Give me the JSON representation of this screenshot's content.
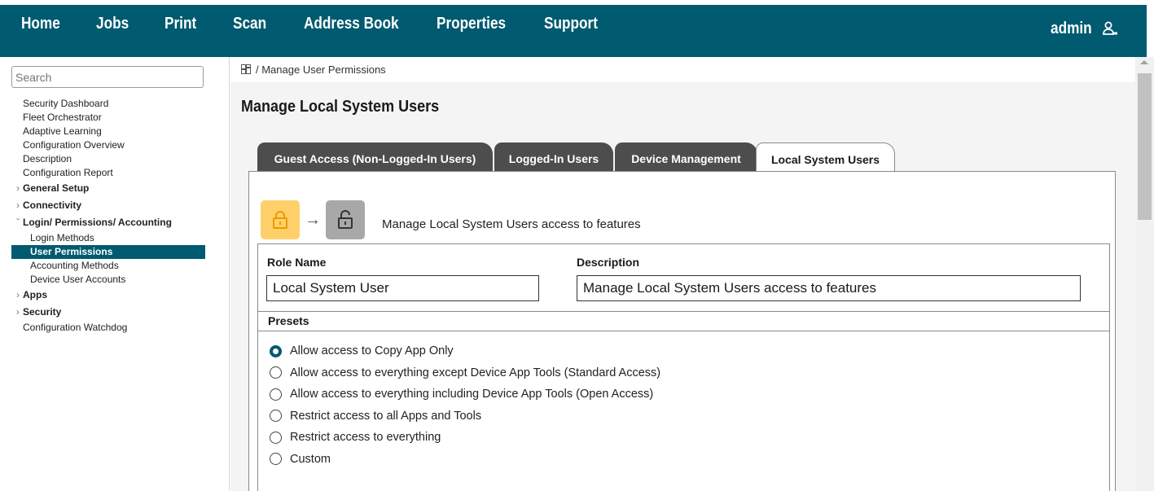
{
  "nav": {
    "items": [
      "Home",
      "Jobs",
      "Print",
      "Scan",
      "Address Book",
      "Properties",
      "Support"
    ],
    "user": "admin"
  },
  "sidebar": {
    "search_placeholder": "Search",
    "items": [
      {
        "label": "Security Dashboard",
        "kind": "top"
      },
      {
        "label": "Fleet Orchestrator",
        "kind": "top"
      },
      {
        "label": "Adaptive Learning",
        "kind": "top"
      },
      {
        "label": "Configuration Overview",
        "kind": "top"
      },
      {
        "label": "Description",
        "kind": "top"
      },
      {
        "label": "Configuration Report",
        "kind": "top"
      },
      {
        "label": "General Setup",
        "kind": "group",
        "chev": "›"
      },
      {
        "label": "Connectivity",
        "kind": "group",
        "chev": "›"
      },
      {
        "label": "Login/ Permissions/ Accounting",
        "kind": "group",
        "chev": "ˇ"
      },
      {
        "label": "Login Methods",
        "kind": "sub"
      },
      {
        "label": "User Permissions",
        "kind": "active"
      },
      {
        "label": "Accounting Methods",
        "kind": "sub"
      },
      {
        "label": "Device User Accounts",
        "kind": "sub"
      },
      {
        "label": "Apps",
        "kind": "group",
        "chev": "›"
      },
      {
        "label": "Security",
        "kind": "group",
        "chev": "›"
      },
      {
        "label": "Configuration Watchdog",
        "kind": "top"
      }
    ]
  },
  "breadcrumb": "/ Manage User Permissions",
  "page_title": "Manage Local System Users",
  "tabs": [
    {
      "label": "Guest Access (Non-Logged-In Users)",
      "active": false
    },
    {
      "label": "Logged-In Users",
      "active": false
    },
    {
      "label": "Device Management",
      "active": false
    },
    {
      "label": "Local System Users",
      "active": true
    }
  ],
  "lock_description": "Manage Local System Users access to features",
  "form": {
    "role_name_label": "Role Name",
    "role_name_value": "Local System User",
    "description_label": "Description",
    "description_value": "Manage Local System Users access to features",
    "presets_label": "Presets",
    "presets": [
      {
        "label": "Allow access to Copy App Only",
        "checked": true
      },
      {
        "label": "Allow access to everything except Device App Tools (Standard Access)",
        "checked": false
      },
      {
        "label": "Allow access to everything including Device App Tools (Open Access)",
        "checked": false
      },
      {
        "label": "Restrict access to all Apps and Tools",
        "checked": false
      },
      {
        "label": "Restrict access to everything",
        "checked": false
      },
      {
        "label": "Custom",
        "checked": false
      }
    ]
  },
  "colors": {
    "brand": "#005a70",
    "tab_inactive": "#4d4d4d",
    "lock_locked": "#ffd06a",
    "lock_unlocked": "#a8a8a8"
  }
}
